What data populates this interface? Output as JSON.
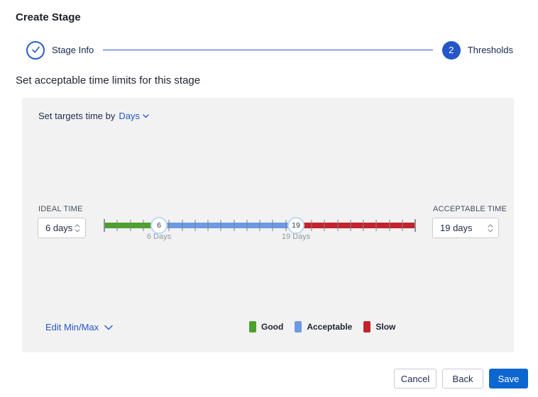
{
  "page": {
    "title": "Create Stage"
  },
  "stepper": {
    "step1": {
      "label": "Stage Info",
      "state": "completed"
    },
    "step2": {
      "number": "2",
      "label": "Thresholds"
    }
  },
  "section": {
    "heading": "Set acceptable time limits for this stage"
  },
  "panel": {
    "targets_prefix": "Set targets time by",
    "targets_unit": "Days",
    "ideal": {
      "label": "IDEAL TIME",
      "value": "6 days"
    },
    "acceptable": {
      "label": "ACCEPTABLE TIME",
      "value": "19 days"
    },
    "slider": {
      "min_handle": {
        "value": "6",
        "caption": "6 Days"
      },
      "max_handle": {
        "value": "19",
        "caption": "19 Days"
      }
    },
    "edit_minmax": "Edit Min/Max",
    "legend": [
      {
        "label": "Good",
        "color": "#4ca12e"
      },
      {
        "label": "Acceptable",
        "color": "#6d9ae4"
      },
      {
        "label": "Slow",
        "color": "#c3232b"
      }
    ]
  },
  "footer": {
    "cancel": "Cancel",
    "back": "Back",
    "save": "Save"
  },
  "colors": {
    "accent_blue": "#2456c8",
    "save_blue": "#0c66d0",
    "good_green": "#4ca12e",
    "acceptable_blue": "#6d9ae4",
    "slow_red": "#c3232b",
    "panel_bg": "#f2f2f3"
  }
}
